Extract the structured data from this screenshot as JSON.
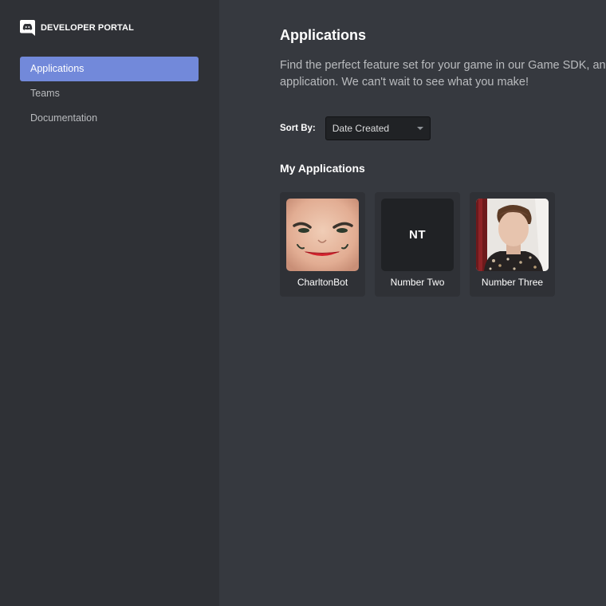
{
  "brand": {
    "title": "DEVELOPER PORTAL",
    "logo_icon": "discord-logo-icon"
  },
  "sidebar": {
    "items": [
      {
        "label": "Applications",
        "active": true
      },
      {
        "label": "Teams",
        "active": false
      },
      {
        "label": "Documentation",
        "active": false
      }
    ]
  },
  "main": {
    "title": "Applications",
    "description_line1": "Find the perfect feature set for your game in our Game SDK, and",
    "description_line2": "application. We can't wait to see what you make!",
    "sort": {
      "label": "Sort By:",
      "selected": "Date Created"
    },
    "section_title": "My Applications",
    "apps": [
      {
        "name": "CharltonBot",
        "icon": "face-avatar"
      },
      {
        "name": "Number Two",
        "initials": "NT"
      },
      {
        "name": "Number Three",
        "icon": "photo-avatar"
      }
    ]
  },
  "colors": {
    "sidebar_bg": "#2f3136",
    "main_bg": "#36393f",
    "accent": "#7289da",
    "card_bg": "#2f3136",
    "input_bg": "#202225"
  }
}
